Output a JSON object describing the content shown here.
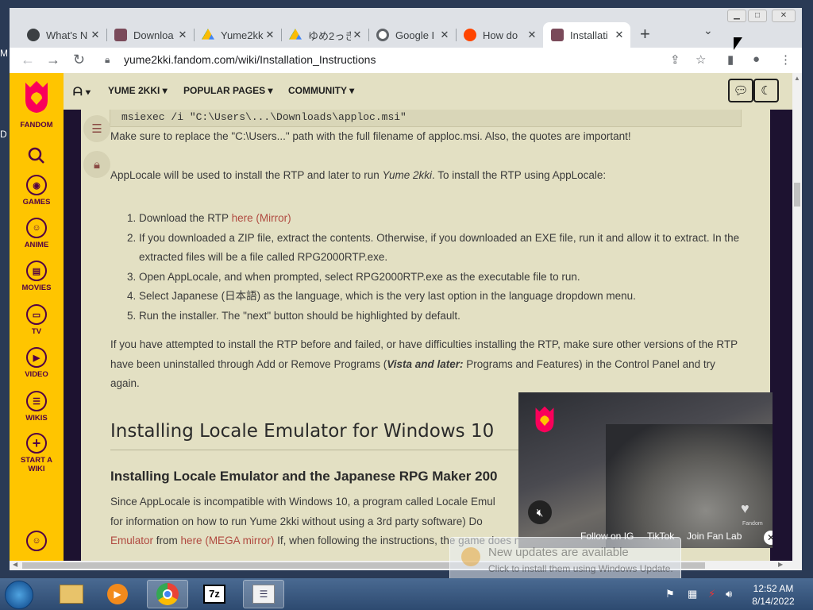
{
  "browser": {
    "tabs": [
      {
        "label": "What's N",
        "icon": "github-icon",
        "color": "#3c4043"
      },
      {
        "label": "Downloa",
        "icon": "yume-icon",
        "color": "#7a4a5a"
      },
      {
        "label": "Yume2kk",
        "icon": "google-drive-icon",
        "color": "#1a73e8"
      },
      {
        "label": "ゆめ2っき",
        "icon": "google-drive-icon",
        "color": "#1a73e8"
      },
      {
        "label": "Google I",
        "icon": "google-icon",
        "color": "#5f6368"
      },
      {
        "label": "How do",
        "icon": "reddit-icon",
        "color": "#ff4500"
      },
      {
        "label": "Installati",
        "icon": "yume-icon",
        "color": "#7a4a5a",
        "active": true
      }
    ],
    "url": "yume2kki.fandom.com/wiki/Installation_Instructions"
  },
  "fandom_rail": {
    "logo_label": "FANDOM",
    "items": [
      {
        "label": "GAMES",
        "icon": "games-icon"
      },
      {
        "label": "ANIME",
        "icon": "anime-icon"
      },
      {
        "label": "MOVIES",
        "icon": "movies-icon"
      },
      {
        "label": "TV",
        "icon": "tv-icon"
      },
      {
        "label": "VIDEO",
        "icon": "video-icon"
      },
      {
        "label": "WIKIS",
        "icon": "wikis-icon"
      },
      {
        "label": "START A WIKI",
        "icon": "plus-icon"
      }
    ]
  },
  "site_nav": {
    "menus": [
      "YUME 2KKI",
      "POPULAR PAGES",
      "COMMUNITY"
    ]
  },
  "article": {
    "code": "msiexec /i \"C:\\Users\\...\\Downloads\\apploc.msi\"",
    "p1": "Make sure to replace the \"C:\\Users...\" path with the full filename of apploc.msi. Also, the quotes are important!",
    "p2a": "AppLocale will be used to install the RTP and later to run ",
    "p2em": "Yume 2kki",
    "p2b": ". To install the RTP using AppLocale:",
    "steps": {
      "s1a": "Download the RTP ",
      "s1link": "here",
      "s1mirror": "(Mirror)",
      "s2": "If you downloaded a ZIP file, extract the contents. Otherwise, if you downloaded an EXE file, run it and allow it to extract. In the extracted files will be a file called RPG2000RTP.exe.",
      "s3": "Open AppLocale, and when prompted, select RPG2000RTP.exe as the executable file to run.",
      "s4": "Select Japanese (日本語) as the language, which is the very last option in the language dropdown menu.",
      "s5": "Run the installer. The \"next\" button should be highlighted by default."
    },
    "p3a": "If you have attempted to install the RTP before and failed, or have difficulties installing the RTP, make sure other versions of the RTP have been uninstalled through Add or Remove Programs (",
    "p3em": "Vista and later:",
    "p3b": " Programs and Features) in the Control Panel and try again.",
    "h2": "Installing Locale Emulator for Windows 10",
    "h3": "Installing Locale Emulator and the Japanese RPG Maker 200",
    "p4a": "Since AppLocale is incompatible with Windows 10, a program called Locale Emul",
    "p4b": "for information on how to run Yume 2kki without using a 3rd party software) Do",
    "p4c_link1": "Emulator",
    "p4c_mid": " from ",
    "p4c_link2": "here (MEGA mirror)",
    "p4c_end": " If, when following the instructions, the game does not operate correctly, download Time"
  },
  "video_overlay": {
    "links": [
      "Follow on IG",
      "TikTok",
      "Join Fan Lab"
    ],
    "brand": "Fandom"
  },
  "notification": {
    "title": "New updates are available",
    "subtitle": "Click to install them using Windows Update."
  },
  "taskbar": {
    "time": "12:52 AM",
    "date": "8/14/2022",
    "apps": [
      "explorer-icon",
      "media-player-icon",
      "chrome-icon",
      "7zip-icon",
      "task-manager-icon"
    ]
  },
  "desktop": {
    "label1": "M",
    "label2": "D"
  }
}
